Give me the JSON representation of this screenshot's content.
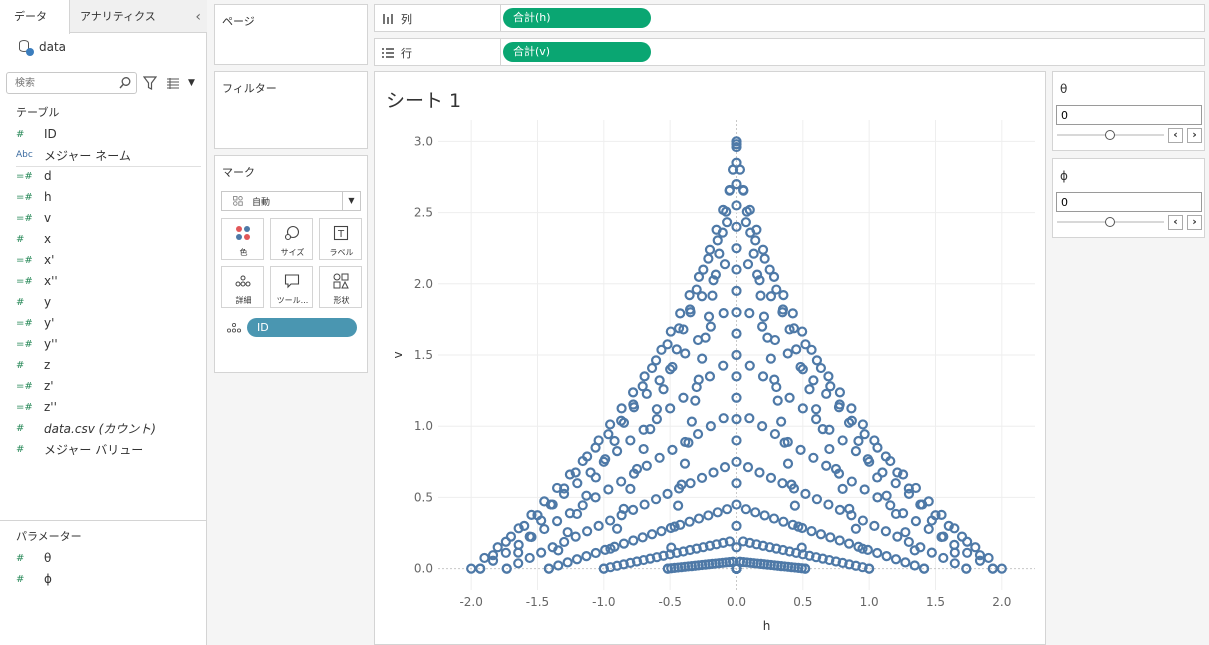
{
  "left_pane": {
    "tabs": [
      {
        "label": "データ"
      },
      {
        "label": "アナリティクス"
      }
    ],
    "collapse_glyph": "‹",
    "datasource": "data",
    "search_placeholder": "検索",
    "tables_header": "テーブル",
    "fields": [
      {
        "icon": "#",
        "label": "ID"
      },
      {
        "icon": "Abc",
        "label": "メジャー ネーム"
      },
      {
        "icon": "=#",
        "label": "d"
      },
      {
        "icon": "=#",
        "label": "h"
      },
      {
        "icon": "=#",
        "label": "v"
      },
      {
        "icon": "#",
        "label": "x"
      },
      {
        "icon": "=#",
        "label": "x'"
      },
      {
        "icon": "=#",
        "label": "x''"
      },
      {
        "icon": "#",
        "label": "y"
      },
      {
        "icon": "=#",
        "label": "y'"
      },
      {
        "icon": "=#",
        "label": "y''"
      },
      {
        "icon": "#",
        "label": "z"
      },
      {
        "icon": "=#",
        "label": "z'"
      },
      {
        "icon": "=#",
        "label": "z''"
      },
      {
        "icon": "#",
        "label": "data.csv (カウント)"
      },
      {
        "icon": "#",
        "label": "メジャー バリュー"
      }
    ],
    "params_header": "パラメーター",
    "params": [
      {
        "icon": "#",
        "label": "θ"
      },
      {
        "icon": "#",
        "label": "ϕ"
      }
    ]
  },
  "pages_title": "ページ",
  "filters_title": "フィルター",
  "marks": {
    "title": "マーク",
    "type": "自動",
    "buttons": [
      {
        "label": "色",
        "icon": "color-icon"
      },
      {
        "label": "サイズ",
        "icon": "size-icon"
      },
      {
        "label": "ラベル",
        "icon": "label-icon"
      },
      {
        "label": "詳細",
        "icon": "detail-icon"
      },
      {
        "label": "ツール...",
        "icon": "tooltip-icon"
      },
      {
        "label": "形状",
        "icon": "shape-icon"
      }
    ],
    "detail_pill": "ID"
  },
  "columns_shelf": {
    "label": "列",
    "pill": "合計(h)"
  },
  "rows_shelf": {
    "label": "行",
    "pill": "合計(v)"
  },
  "sheet_title": "シート 1",
  "parameters": [
    {
      "name": "θ",
      "value": "0",
      "slider_fraction": 0.5
    },
    {
      "name": "ϕ",
      "value": "0",
      "slider_fraction": 0.5
    }
  ],
  "colors": {
    "mark": "#4e79a7",
    "columns_pill": "#0aa672",
    "detail_pill": "#4a96b1"
  },
  "chart_data": {
    "type": "scatter",
    "xlabel": "h",
    "ylabel": "v",
    "xlim": [
      -2.25,
      2.25
    ],
    "ylim": [
      -0.15,
      3.15
    ],
    "xticks": [
      "-2.0",
      "-1.5",
      "-1.0",
      "-0.5",
      "0.0",
      "0.5",
      "1.0",
      "1.5",
      "2.0"
    ],
    "yticks": [
      "0.0",
      "0.5",
      "1.0",
      "1.5",
      "2.0",
      "2.5",
      "3.0"
    ],
    "marker": "open-circle",
    "series": [
      {
        "description": "concentric rings of a cone (z = 3 - 1.5r) viewed from side, r = 0..2 step 0.1, points every 15°",
        "ring_radii": [
          0.1,
          0.2,
          0.3,
          0.4,
          0.5,
          0.6,
          0.7,
          0.8,
          0.9,
          1.0,
          1.1,
          1.2,
          1.3,
          1.4,
          1.5,
          1.6,
          1.7,
          1.8,
          1.9,
          2.0
        ],
        "cone_height": 3.0,
        "points_per_ring": 24,
        "apex": [
          0.0,
          3.0
        ]
      }
    ]
  }
}
